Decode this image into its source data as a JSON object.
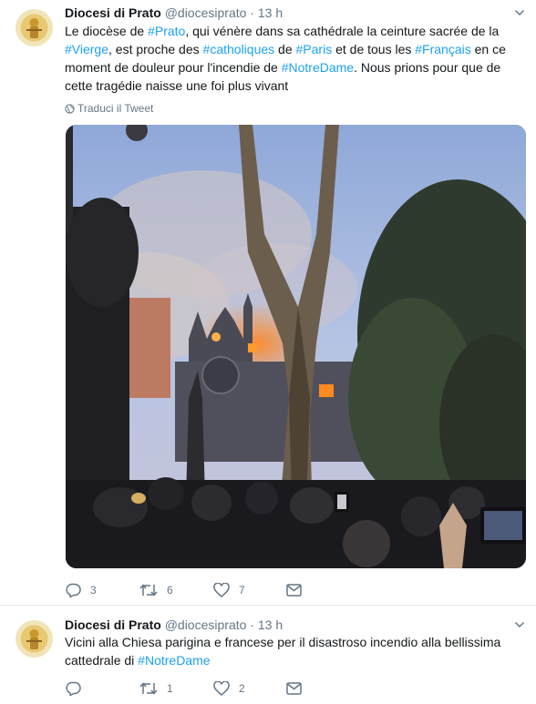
{
  "tweets": [
    {
      "name": "Diocesi di Prato",
      "handle": "@diocesiprato",
      "sep": "·",
      "time": "13 h",
      "text_segments": [
        {
          "t": "Le diocèse de ",
          "tag": false
        },
        {
          "t": "#Prato",
          "tag": true
        },
        {
          "t": ", qui vénère dans sa cathédrale la ceinture sacrée de la ",
          "tag": false
        },
        {
          "t": "#Vierge",
          "tag": true
        },
        {
          "t": ", est proche des ",
          "tag": false
        },
        {
          "t": "#catholiques",
          "tag": true
        },
        {
          "t": " de ",
          "tag": false
        },
        {
          "t": "#Paris",
          "tag": true
        },
        {
          "t": " et de tous les ",
          "tag": false
        },
        {
          "t": "#Français",
          "tag": true
        },
        {
          "t": " en ce moment de douleur pour l'incendie de ",
          "tag": false
        },
        {
          "t": "#NotreDame",
          "tag": true
        },
        {
          "t": ". Nous prions pour que de cette tragédie naisse une foi plus vivant",
          "tag": false
        }
      ],
      "translate_label": "Traduci il Tweet",
      "replies": "3",
      "retweets": "6",
      "likes": "7"
    },
    {
      "name": "Diocesi di Prato",
      "handle": "@diocesiprato",
      "sep": "·",
      "time": "13 h",
      "text_segments": [
        {
          "t": "Vicini alla Chiesa parigina e francese per il disastroso incendio alla bellissima cattedrale di ",
          "tag": false
        },
        {
          "t": "#NotreDame",
          "tag": true
        }
      ],
      "replies": "",
      "retweets": "1",
      "likes": "2"
    }
  ],
  "colors": {
    "link": "#1da1f2",
    "muted": "#657786",
    "text": "#14171a"
  },
  "icons": [
    "avatar-emblem",
    "globe-icon",
    "reply-icon",
    "retweet-icon",
    "like-icon",
    "dm-icon",
    "chevron-down-icon"
  ]
}
